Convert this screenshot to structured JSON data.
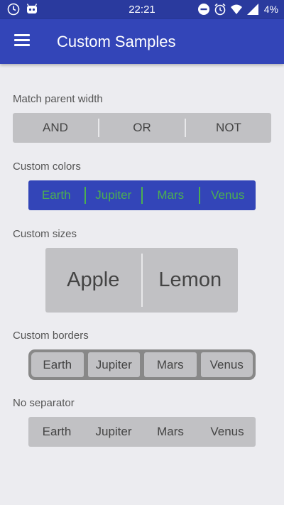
{
  "status_bar": {
    "time": "22:21",
    "battery": "4%",
    "left_icons": [
      "clock-icon",
      "android-debug-icon"
    ],
    "right_icons": [
      "do-not-disturb-icon",
      "alarm-icon",
      "wifi-icon",
      "signal-icon"
    ]
  },
  "toolbar": {
    "title": "Custom Samples",
    "menu_icon": "hamburger-menu-icon"
  },
  "colors": {
    "toolbar": "#3345b8",
    "status_bar": "#2a3a9e",
    "background": "#ececf0",
    "segment_gray": "#c1c1c4",
    "custom_text_green": "#4caf50"
  },
  "sections": [
    {
      "label": "Match parent width",
      "items": [
        "AND",
        "OR",
        "NOT"
      ]
    },
    {
      "label": "Custom colors",
      "items": [
        "Earth",
        "Jupiter",
        "Mars",
        "Venus"
      ]
    },
    {
      "label": "Custom sizes",
      "items": [
        "Apple",
        "Lemon"
      ]
    },
    {
      "label": "Custom borders",
      "items": [
        "Earth",
        "Jupiter",
        "Mars",
        "Venus"
      ]
    },
    {
      "label": "No separator",
      "items": [
        "Earth",
        "Jupiter",
        "Mars",
        "Venus"
      ]
    }
  ]
}
